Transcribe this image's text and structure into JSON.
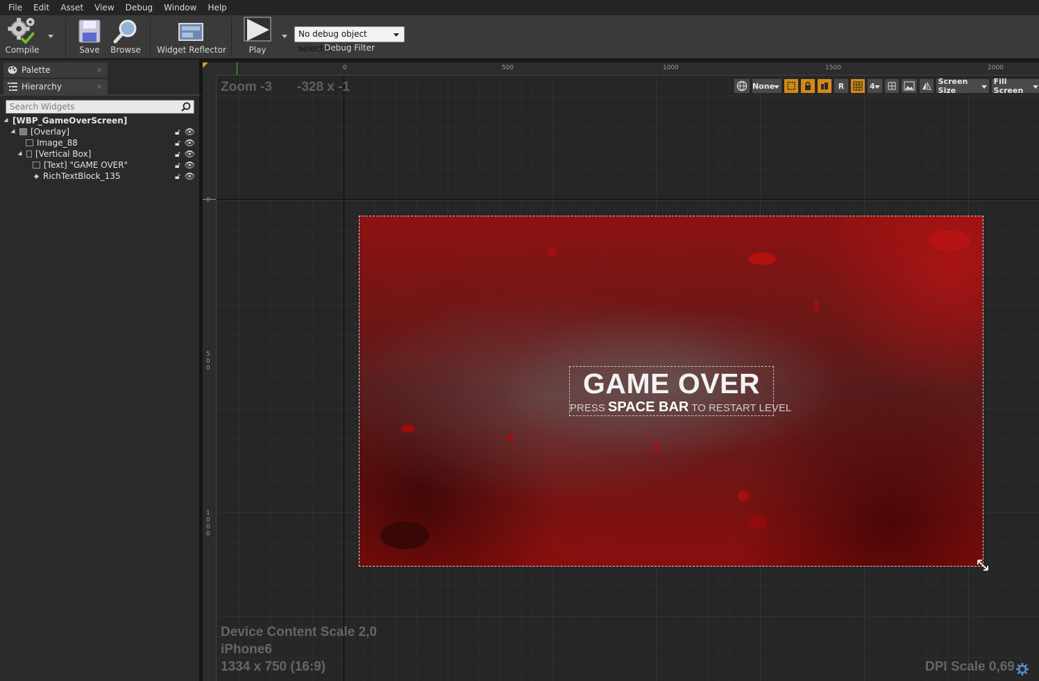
{
  "menu": {
    "items": [
      "File",
      "Edit",
      "Asset",
      "View",
      "Debug",
      "Window",
      "Help"
    ]
  },
  "toolbar": {
    "compile_label": "Compile",
    "save_label": "Save",
    "browse_label": "Browse",
    "widget_reflector_label": "Widget Reflector",
    "play_label": "Play",
    "debug_select_value": "No debug object selected",
    "debug_filter_label": "Debug Filter"
  },
  "left_panel": {
    "tabs": [
      {
        "label": "Palette",
        "icon": "palette-icon"
      },
      {
        "label": "Hierarchy",
        "icon": "hierarchy-icon"
      }
    ],
    "search_placeholder": "Search Widgets",
    "tree": [
      {
        "label": "[WBP_GameOverScreen]",
        "level": 0,
        "expanded": true,
        "bold": true
      },
      {
        "label": "[Overlay]",
        "level": 1,
        "expanded": true,
        "icon": "overlay-icon"
      },
      {
        "label": "Image_88",
        "level": 2,
        "icon": "image-icon"
      },
      {
        "label": "[Vertical Box]",
        "level": 2,
        "expanded": true,
        "icon": "vertical-box-icon"
      },
      {
        "label": "[Text] \"GAME OVER\"",
        "level": 3,
        "icon": "text-icon"
      },
      {
        "label": "RichTextBlock_135",
        "level": 3,
        "icon": "rich-text-icon"
      }
    ]
  },
  "designer": {
    "zoom_text": "Zoom -3",
    "coord_text": "-328 x -1",
    "ruler_top": [
      "0",
      "500",
      "1000",
      "1500",
      "2000"
    ],
    "ruler_left": [
      "0",
      "5\n0\n0",
      "1\n0\n0\n0"
    ],
    "vp_toolbar": {
      "none_label": "None",
      "r_label": "R",
      "grid_snap_value": "4",
      "screen_size_label": "Screen Size",
      "fill_screen_label": "Fill Screen"
    },
    "widget": {
      "title": "GAME OVER",
      "restart_prefix": "PRESS",
      "restart_key": "SPACE BAR",
      "restart_suffix": "TO RESTART LEVEL"
    },
    "device_scale": "Device Content Scale 2,0",
    "device_name": "iPhone6",
    "resolution": "1334 x 750 (16:9)",
    "dpi_scale": "DPI Scale 0,69"
  },
  "colors": {
    "accent_orange": "#d38a16",
    "blood_red": "#8e1212",
    "panel_bg": "#2a2a2a",
    "canvas_bg": "#262626"
  }
}
